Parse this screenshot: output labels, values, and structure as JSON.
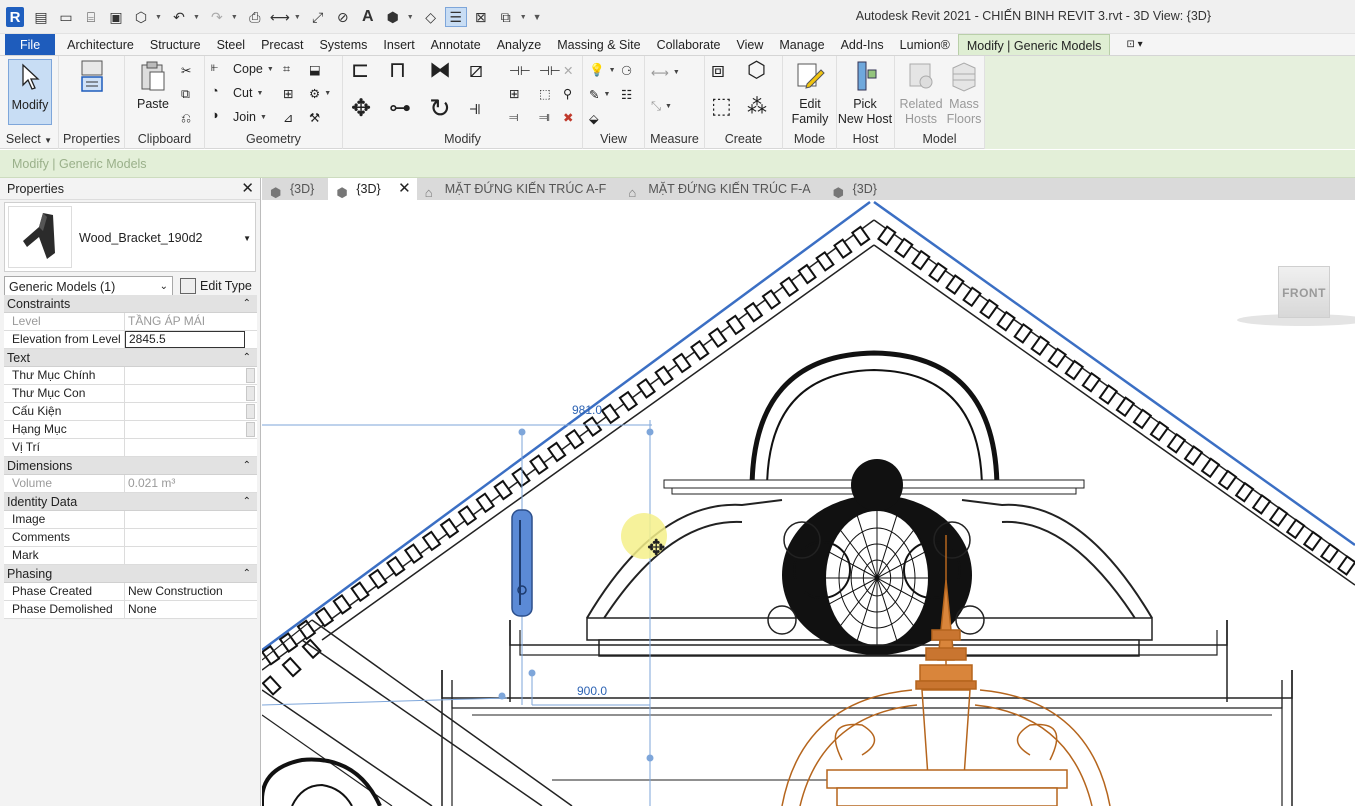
{
  "app": {
    "title": "Autodesk Revit 2021 - CHIẾN BINH REVIT 3.rvt - 3D View: {3D}",
    "logo": "R"
  },
  "ribbon_tabs": [
    "File",
    "Architecture",
    "Structure",
    "Steel",
    "Precast",
    "Systems",
    "Insert",
    "Annotate",
    "Analyze",
    "Massing & Site",
    "Collaborate",
    "View",
    "Manage",
    "Add-Ins",
    "Lumion®",
    "Modify | Generic Models"
  ],
  "ribbon": {
    "modify_label": "Modify",
    "select_label": "Select",
    "properties_label": "Properties",
    "paste_label": "Paste",
    "clipboard_label": "Clipboard",
    "cope_label": "Cope",
    "cut_label": "Cut",
    "join_label": "Join",
    "geometry_label": "Geometry",
    "modify_panel_label": "Modify",
    "view_label": "View",
    "measure_label": "Measure",
    "create_label": "Create",
    "edit_family_line1": "Edit",
    "edit_family_line2": "Family",
    "mode_label": "Mode",
    "pick_host_line1": "Pick",
    "pick_host_line2": "New Host",
    "host_label": "Host",
    "related_hosts_line1": "Related",
    "related_hosts_line2": "Hosts",
    "mass_floors_line1": "Mass",
    "mass_floors_line2": "Floors",
    "model_label": "Model"
  },
  "options_bar": {
    "context": "Modify | Generic Models"
  },
  "properties": {
    "title": "Properties",
    "type_name": "Wood_Bracket_190d2",
    "filter": "Generic Models (1)",
    "edit_type": "Edit Type",
    "groups": {
      "constraints": "Constraints",
      "text": "Text",
      "dimensions": "Dimensions",
      "identity": "Identity Data",
      "phasing": "Phasing"
    },
    "rows": {
      "level_k": "Level",
      "level_v": "TẦNG ÁP MÁI",
      "elev_k": "Elevation from Level",
      "elev_v": "2845.5",
      "thu_muc_chinh": "Thư Mục Chính",
      "thu_muc_con": "Thư Mục Con",
      "cau_kien": "Cấu Kiện",
      "hang_muc": "Hạng Mục",
      "vi_tri": "Vị Trí",
      "volume_k": "Volume",
      "volume_v": "0.021 m³",
      "image": "Image",
      "comments": "Comments",
      "mark": "Mark",
      "phase_created_k": "Phase Created",
      "phase_created_v": "New Construction",
      "phase_demolished_k": "Phase Demolished",
      "phase_demolished_v": "None"
    }
  },
  "view_tabs": [
    {
      "label": "{3D}",
      "active": false
    },
    {
      "label": "{3D}",
      "active": true
    },
    {
      "label": "MẶT ĐỨNG KIẾN TRÚC A-F",
      "active": false
    },
    {
      "label": "MẶT ĐỨNG KIẾN TRÚC F-A",
      "active": false
    },
    {
      "label": "{3D}",
      "active": false
    }
  ],
  "canvas": {
    "viewcube": "FRONT",
    "dim_top": "981.0",
    "dim_bottom": "900.0"
  },
  "colors": {
    "file_tab": "#1e5cbc",
    "context_tab": "#dfeed3",
    "selection_blue": "#2e64b4",
    "spire_orange": "#b5651d"
  }
}
